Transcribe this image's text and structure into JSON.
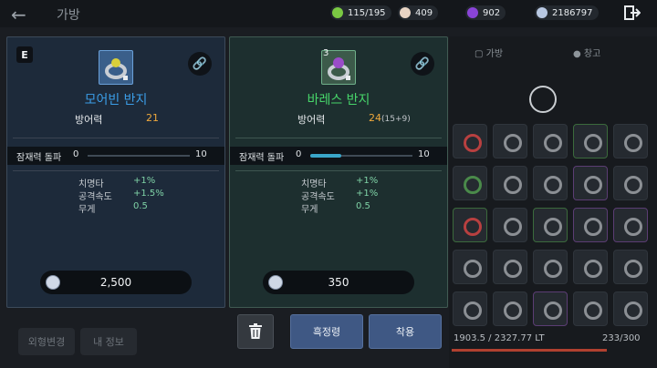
{
  "header": {
    "title": "가방",
    "resources": [
      {
        "value": "115/195",
        "color": "#7ac943"
      },
      {
        "value": "409",
        "color": "#e8d4c4"
      },
      {
        "value": "902",
        "color": "#8a44d8"
      },
      {
        "value": "2186797",
        "color": "#b8c8e2"
      }
    ]
  },
  "background": {
    "tabs": [
      "가방",
      "창고"
    ],
    "weight": "1903.5 / 2327.77 LT",
    "capacity": "233/300",
    "buttons": [
      "외형변경",
      "내 정보"
    ]
  },
  "cards": [
    {
      "grade": "E",
      "name": "모어빈 반지",
      "name_color": "#3b9ee8",
      "stat_label": "방어력",
      "stat_value": "21",
      "stat_bonus": "",
      "potential_label": "잠재력 돌파",
      "potential_min": "0",
      "potential_max": "10",
      "potential_fill": 0.0,
      "substats": [
        {
          "label": "치명타",
          "value": "+1%"
        },
        {
          "label": "공격속도",
          "value": "+1.5%"
        },
        {
          "label": "무게",
          "value": "0.5"
        }
      ],
      "price": "2,500"
    },
    {
      "grade": "",
      "enhance": "3",
      "name": "바레스 반지",
      "name_color": "#47d66a",
      "stat_label": "방어력",
      "stat_value": "24",
      "stat_bonus": "(15+9)",
      "potential_label": "잠재력 돌파",
      "potential_min": "0",
      "potential_max": "10",
      "potential_fill": 0.3,
      "substats": [
        {
          "label": "치명타",
          "value": "+1%"
        },
        {
          "label": "공격속도",
          "value": "+1%"
        },
        {
          "label": "무게",
          "value": "0.5"
        }
      ],
      "price": "350"
    }
  ],
  "actions": {
    "black_essence": "흑정령",
    "equip": "착용"
  }
}
